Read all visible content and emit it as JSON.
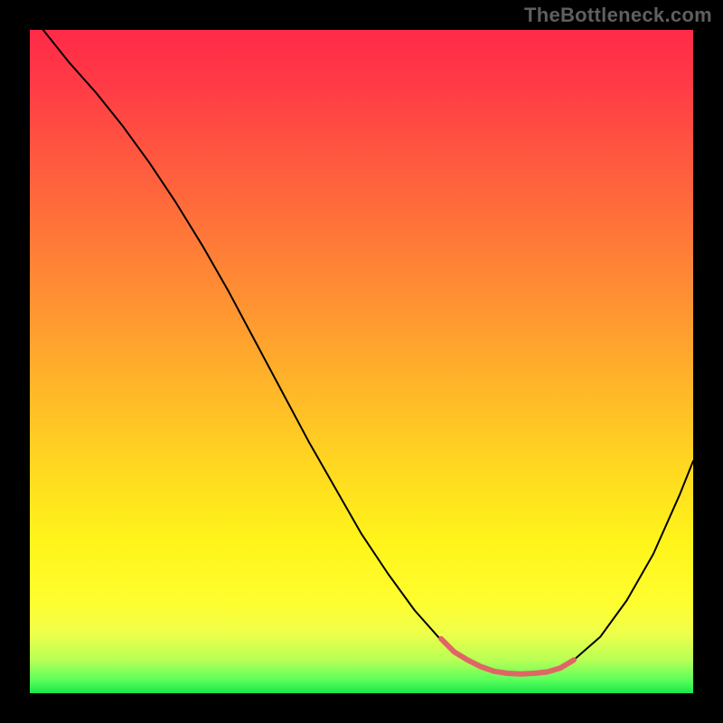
{
  "watermark": "TheBottleneck.com",
  "chart_data": {
    "type": "line",
    "title": "",
    "xlabel": "",
    "ylabel": "",
    "xlim": [
      0,
      100
    ],
    "ylim": [
      0,
      100
    ],
    "grid": false,
    "gradient_stops": [
      {
        "pct": 0,
        "color": "#ff2a47"
      },
      {
        "pct": 8,
        "color": "#ff3a46"
      },
      {
        "pct": 20,
        "color": "#ff5a3f"
      },
      {
        "pct": 32,
        "color": "#ff7a38"
      },
      {
        "pct": 44,
        "color": "#ff9a30"
      },
      {
        "pct": 55,
        "color": "#ffb928"
      },
      {
        "pct": 66,
        "color": "#ffd820"
      },
      {
        "pct": 77,
        "color": "#fff41a"
      },
      {
        "pct": 86,
        "color": "#fffd2e"
      },
      {
        "pct": 91,
        "color": "#eeff4a"
      },
      {
        "pct": 95,
        "color": "#b8ff55"
      },
      {
        "pct": 98,
        "color": "#5cff5c"
      },
      {
        "pct": 100,
        "color": "#18e84a"
      }
    ],
    "series": [
      {
        "name": "curve-main",
        "color": "#000000",
        "width": 2.0,
        "x": [
          2,
          6,
          10,
          14,
          18,
          22,
          26,
          30,
          34,
          38,
          42,
          46,
          50,
          54,
          58,
          62,
          64,
          66,
          68,
          70,
          72,
          74,
          76,
          78,
          80,
          82,
          86,
          90,
          94,
          98,
          100
        ],
        "y": [
          100,
          95,
          90.5,
          85.5,
          80,
          74,
          67.5,
          60.5,
          53,
          45.5,
          38,
          31,
          24,
          18,
          12.5,
          8,
          6.2,
          5,
          4,
          3.3,
          3,
          2.9,
          3,
          3.2,
          3.8,
          5,
          8.5,
          14,
          21,
          30,
          35
        ]
      },
      {
        "name": "curve-accent",
        "color": "#e06666",
        "width": 6.0,
        "x": [
          62,
          64,
          66,
          68,
          70,
          72,
          74,
          76,
          78,
          80,
          82
        ],
        "y": [
          8.2,
          6.2,
          5,
          4,
          3.3,
          3,
          2.9,
          3,
          3.2,
          3.8,
          5
        ]
      }
    ]
  }
}
